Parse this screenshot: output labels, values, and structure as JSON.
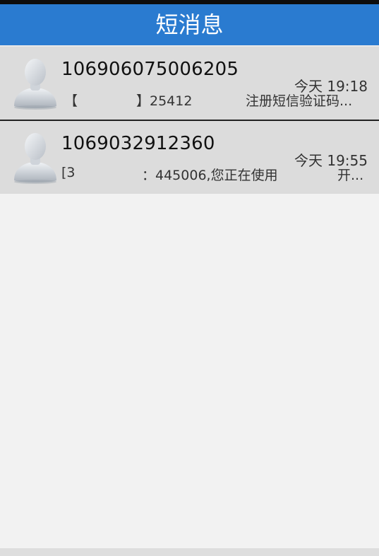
{
  "header": {
    "title": "短消息"
  },
  "messages": [
    {
      "sender": "106906075006205",
      "time": "今天 19:18",
      "preview_start": "【",
      "preview_middle": "】25412",
      "preview_end": "注册短信验证码..."
    },
    {
      "sender": "1069032912360",
      "time": "今天 19:55",
      "preview_start": "[3",
      "preview_middle": "：445006,您正在使用",
      "preview_end": "开..."
    }
  ],
  "icons": {
    "avatar": "default-contact-avatar-icon"
  },
  "colors": {
    "header_bg": "#2a7bd0",
    "item_bg": "#dcdcdc",
    "page_bg": "#f2f2f2"
  }
}
